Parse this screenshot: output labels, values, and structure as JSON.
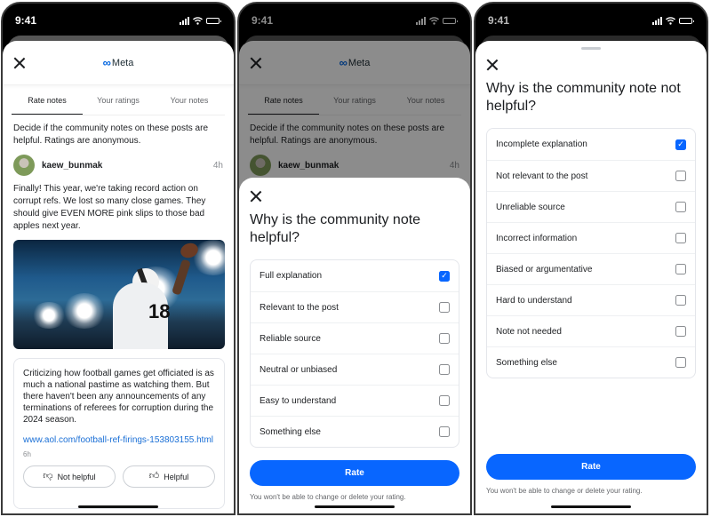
{
  "status": {
    "time": "9:41"
  },
  "screen1": {
    "brand": "Meta",
    "tabs": [
      {
        "label": "Rate notes",
        "active": true
      },
      {
        "label": "Your ratings",
        "active": false
      },
      {
        "label": "Your notes",
        "active": false
      }
    ],
    "description": "Decide if the community notes on these posts are helpful. Ratings are anonymous.",
    "post": {
      "username": "kaew_bunmak",
      "time": "4h",
      "text": "Finally! This year, we're taking record action on corrupt refs. We lost so many close games. They should give EVEN MORE pink slips to those bad apples next year.",
      "image_jersey_number": "18"
    },
    "note": {
      "text": "Criticizing how football games get officiated is as much a national pastime as watching them. But there haven't been any announcements of any terminations of referees for corruption during the 2024 season.",
      "link": "www.aol.com/football-ref-firings-153803155.html",
      "time": "6h",
      "not_helpful_label": "Not helpful",
      "helpful_label": "Helpful"
    }
  },
  "screen2": {
    "title": "Why is the community note helpful?",
    "options": [
      {
        "label": "Full explanation",
        "checked": true
      },
      {
        "label": "Relevant to the post",
        "checked": false
      },
      {
        "label": "Reliable source",
        "checked": false
      },
      {
        "label": "Neutral or unbiased",
        "checked": false
      },
      {
        "label": "Easy to understand",
        "checked": false
      },
      {
        "label": "Something else",
        "checked": false
      }
    ],
    "rate_label": "Rate",
    "disclaimer": "You won't be able to change or delete your rating."
  },
  "screen3": {
    "title": "Why is the community note not helpful?",
    "options": [
      {
        "label": "Incomplete explanation",
        "checked": true
      },
      {
        "label": "Not relevant to the post",
        "checked": false
      },
      {
        "label": "Unreliable source",
        "checked": false
      },
      {
        "label": "Incorrect information",
        "checked": false
      },
      {
        "label": "Biased or argumentative",
        "checked": false
      },
      {
        "label": "Hard to understand",
        "checked": false
      },
      {
        "label": "Note not needed",
        "checked": false
      },
      {
        "label": "Something else",
        "checked": false
      }
    ],
    "rate_label": "Rate",
    "disclaimer": "You won't be able to change or delete your rating."
  },
  "colors": {
    "accent": "#0866ff",
    "link": "#1a6fd6"
  }
}
